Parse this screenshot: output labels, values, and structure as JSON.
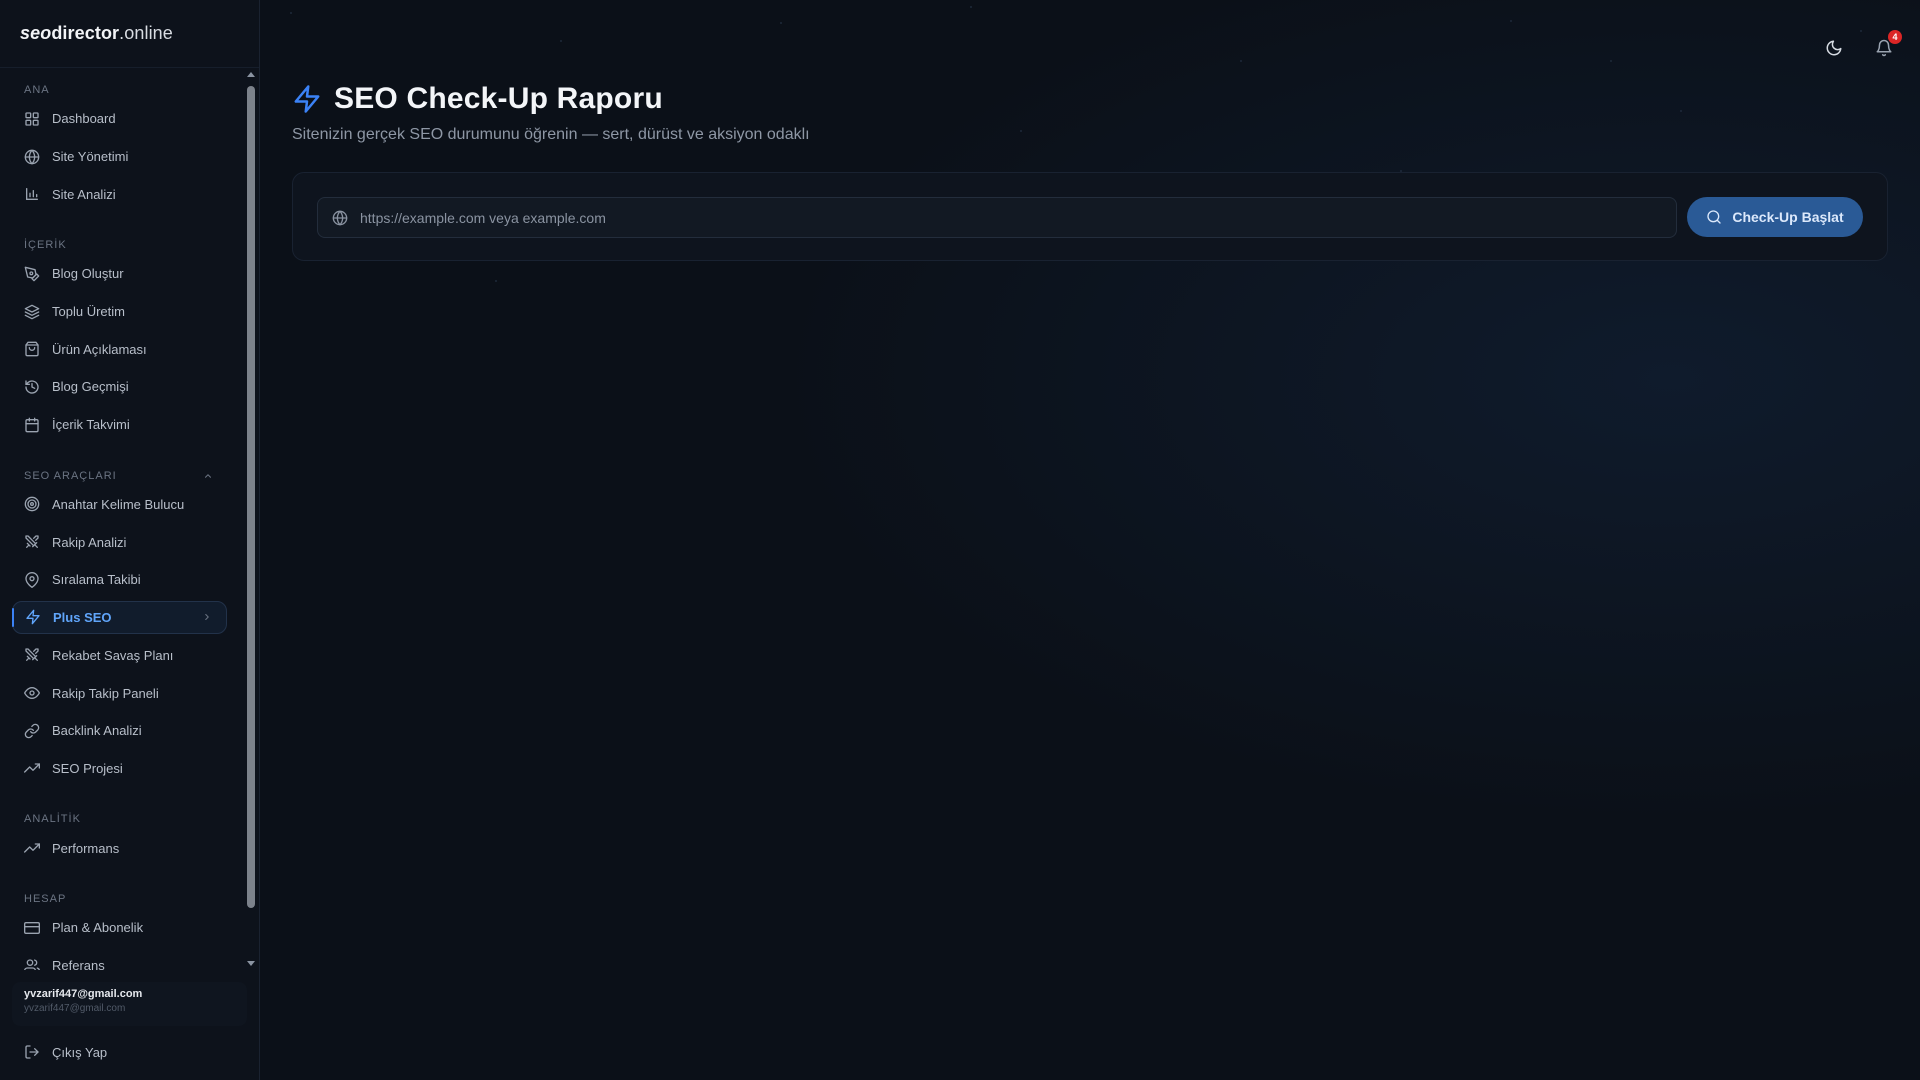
{
  "brand": {
    "part1": "seo",
    "part2": "director",
    "part3": ".online"
  },
  "sidebar": {
    "sections": [
      {
        "label": "ANA",
        "items": [
          {
            "label": "Dashboard",
            "icon": "dashboard-icon"
          },
          {
            "label": "Site Yönetimi",
            "icon": "globe-icon"
          },
          {
            "label": "Site Analizi",
            "icon": "bar-chart-icon"
          }
        ]
      },
      {
        "label": "İÇERİK",
        "items": [
          {
            "label": "Blog Oluştur",
            "icon": "pen-tool-icon"
          },
          {
            "label": "Toplu Üretim",
            "icon": "layers-icon"
          },
          {
            "label": "Ürün Açıklaması",
            "icon": "shopping-bag-icon"
          },
          {
            "label": "Blog Geçmişi",
            "icon": "history-icon"
          },
          {
            "label": "İçerik Takvimi",
            "icon": "calendar-icon"
          }
        ]
      },
      {
        "label": "SEO ARAÇLARI",
        "items": [
          {
            "label": "Anahtar Kelime Bulucu",
            "icon": "target-icon"
          },
          {
            "label": "Rakip Analizi",
            "icon": "swords-icon"
          },
          {
            "label": "Sıralama Takibi",
            "icon": "map-pin-icon"
          },
          {
            "label": "Plus SEO",
            "icon": "zap-icon",
            "active": true
          },
          {
            "label": "Rekabet Savaş Planı",
            "icon": "swords-icon"
          },
          {
            "label": "Rakip Takip Paneli",
            "icon": "eye-icon"
          },
          {
            "label": "Backlink Analizi",
            "icon": "link-icon"
          },
          {
            "label": "SEO Projesi",
            "icon": "trending-up-icon"
          }
        ]
      },
      {
        "label": "ANALİTİK",
        "items": [
          {
            "label": "Performans",
            "icon": "trending-up-icon"
          }
        ]
      },
      {
        "label": "HESAP",
        "items": [
          {
            "label": "Plan & Abonelik",
            "icon": "credit-card-icon"
          },
          {
            "label": "Referans",
            "icon": "users-icon"
          }
        ]
      }
    ]
  },
  "user": {
    "email": "yvzarif447@gmail.com",
    "email_secondary": "yvzarif447@gmail.com"
  },
  "logout_label": "Çıkış Yap",
  "topbar": {
    "notification_count": "4"
  },
  "page": {
    "title": "SEO Check-Up Raporu",
    "subtitle": "Sitenizin gerçek SEO durumunu öğrenin — sert, dürüst ve aksiyon odaklı"
  },
  "url_input": {
    "placeholder": "https://example.com veya example.com",
    "value": ""
  },
  "start_button_label": "Check-Up Başlat",
  "colors": {
    "accent": "#3b82f6",
    "active_text": "#60a5fa",
    "badge": "#dc2626",
    "button_bg": "#2a5a96"
  }
}
